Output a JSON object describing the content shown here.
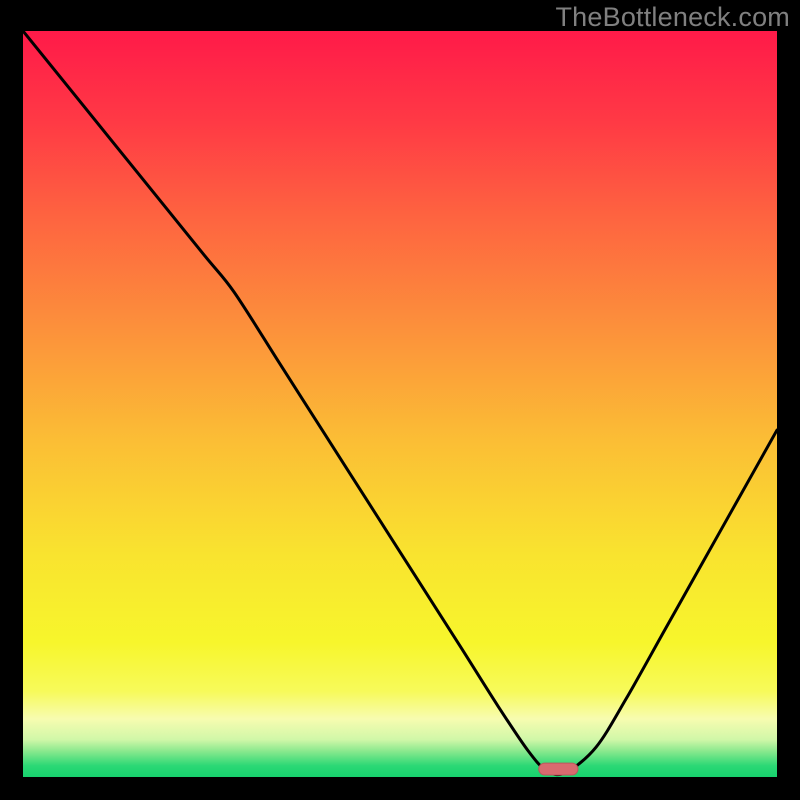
{
  "watermark": "TheBottleneck.com",
  "colors": {
    "black": "#000000",
    "line": "#000000",
    "marker_fill": "#d86a6f",
    "marker_stroke": "#bb585d",
    "gradient_stops": [
      {
        "offset": 0.0,
        "color": "#ff1a49"
      },
      {
        "offset": 0.12,
        "color": "#ff3945"
      },
      {
        "offset": 0.25,
        "color": "#fe6440"
      },
      {
        "offset": 0.4,
        "color": "#fc913b"
      },
      {
        "offset": 0.55,
        "color": "#fbbe35"
      },
      {
        "offset": 0.7,
        "color": "#f9e32f"
      },
      {
        "offset": 0.82,
        "color": "#f7f62c"
      },
      {
        "offset": 0.885,
        "color": "#f7fa5a"
      },
      {
        "offset": 0.922,
        "color": "#f7fcb0"
      },
      {
        "offset": 0.95,
        "color": "#d0f7a8"
      },
      {
        "offset": 0.965,
        "color": "#8be98e"
      },
      {
        "offset": 0.985,
        "color": "#2bd875"
      },
      {
        "offset": 1.0,
        "color": "#17d26e"
      }
    ]
  },
  "chart_data": {
    "type": "line",
    "title": "",
    "xlabel": "",
    "ylabel": "",
    "xlim": [
      0,
      100
    ],
    "ylim": [
      0,
      100
    ],
    "series": [
      {
        "name": "bottleneck-curve",
        "x": [
          0,
          8,
          16,
          24,
          28,
          34,
          40,
          46,
          52,
          58,
          63,
          67,
          69.5,
          72,
          76,
          80,
          85,
          90,
          95,
          100
        ],
        "y": [
          100,
          90,
          80,
          70,
          65,
          55.5,
          46,
          36.5,
          27,
          17.5,
          9.5,
          3.5,
          0.8,
          0.6,
          4,
          10.5,
          19.5,
          28.5,
          37.5,
          46.5
        ]
      }
    ],
    "marker": {
      "x_center": 71.0,
      "width": 5.2,
      "height": 1.6
    }
  }
}
